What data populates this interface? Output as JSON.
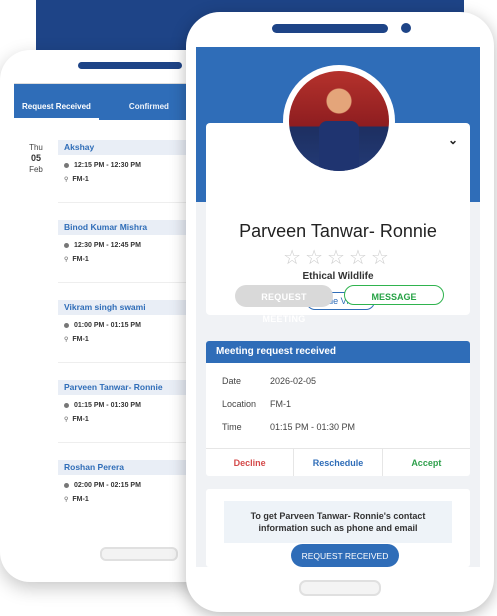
{
  "back_phone": {
    "tabs": [
      {
        "label": "Request Received",
        "active": true
      },
      {
        "label": "Confirmed",
        "active": false
      }
    ],
    "date": {
      "weekday": "Thu",
      "day": "05",
      "month": "Feb"
    },
    "appointments": [
      {
        "name": "Akshay",
        "time": "12:15 PM - 12:30 PM",
        "location": "FM-1"
      },
      {
        "name": "Binod Kumar Mishra",
        "time": "12:30 PM - 12:45 PM",
        "location": "FM-1"
      },
      {
        "name": "Vikram singh swami",
        "time": "01:00 PM - 01:15 PM",
        "location": "FM-1"
      },
      {
        "name": "Parveen Tanwar- Ronnie",
        "time": "01:15 PM - 01:30 PM",
        "location": "FM-1"
      },
      {
        "name": "Roshan Perera",
        "time": "02:00 PM - 02:15 PM",
        "location": "FM-1"
      }
    ]
  },
  "profile": {
    "name": "Parveen Tanwar- Ronnie",
    "rating_stars": "☆☆☆☆☆",
    "rating": 0,
    "rating_max": 5,
    "company": "Ethical Wildlife",
    "visitor_type": "Trade Visitor",
    "request_meeting_label": "REQUEST MEETING",
    "message_label": "MESSAGE"
  },
  "meeting": {
    "header": "Meeting request received",
    "date_label": "Date",
    "date_value": "2026-02-05",
    "location_label": "Location",
    "location_value": "FM-1",
    "time_label": "Time",
    "time_value": "01:15 PM - 01:30 PM",
    "decline_label": "Decline",
    "reschedule_label": "Reschedule",
    "accept_label": "Accept"
  },
  "contact": {
    "line1": "To get Parveen Tanwar- Ronnie's contact",
    "line2": "information such as phone and email"
  },
  "request_received_label": "REQUEST RECEIVED",
  "colors": {
    "brand_dark": "#1e4487",
    "brand": "#2f6db8",
    "decline": "#d44a4a",
    "accept": "#2fa04c"
  }
}
